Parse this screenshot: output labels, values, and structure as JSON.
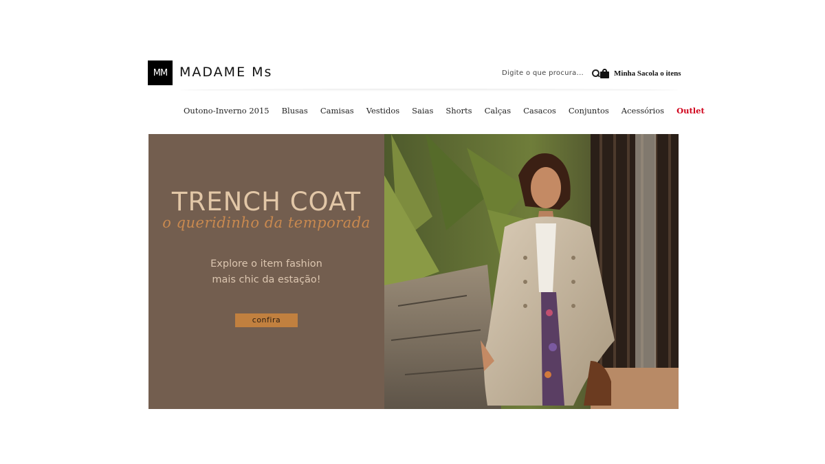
{
  "header": {
    "logo_monogram": "MM",
    "brand_name": "MADAME Ms",
    "search_placeholder": "Digite o que procura...",
    "bag_label": "Minha Sacola o itens"
  },
  "nav": {
    "items": [
      {
        "label": "Outono-Inverno 2015"
      },
      {
        "label": "Blusas"
      },
      {
        "label": "Camisas"
      },
      {
        "label": "Vestidos"
      },
      {
        "label": "Saias"
      },
      {
        "label": "Shorts"
      },
      {
        "label": "Calças"
      },
      {
        "label": "Casacos"
      },
      {
        "label": "Conjuntos"
      },
      {
        "label": "Acessórios"
      },
      {
        "label": "Outlet"
      }
    ]
  },
  "banner": {
    "title": "TRENCH COAT",
    "subtitle": "o queridinho da temporada",
    "desc_line1": "Explore o item fashion",
    "desc_line2": "mais chic da  estação!",
    "cta_label": "confira"
  },
  "colors": {
    "banner_bg": "#735e4f",
    "title": "#e2c7a7",
    "subtitle": "#c9894f",
    "cta": "#c1803f",
    "outlet": "#d0021b"
  }
}
